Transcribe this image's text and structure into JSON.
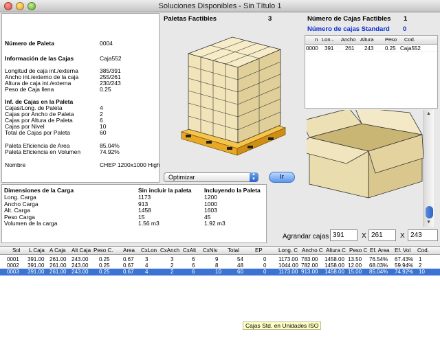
{
  "window": {
    "title": "Soluciones Disponibles - Sin Título 1"
  },
  "info": [
    {
      "label": "Número de Paleta",
      "value": "0004",
      "bold": true
    },
    {
      "label": "Información de las Cajas",
      "value": "Caja552",
      "bold": true
    },
    {
      "label": "Longitud de caja int./externa",
      "value": "385/391",
      "bold": false
    },
    {
      "label": "Ancho int./externo de la caja",
      "value": "255/261",
      "bold": false
    },
    {
      "label": "Altura de caja int./externa",
      "value": "230/243",
      "bold": false
    },
    {
      "label": "Peso de Caja llena",
      "value": "0.25",
      "bold": false
    },
    {
      "label": "Inf. de Cajas en la Paleta",
      "value": "",
      "bold": true
    },
    {
      "label": "Cajas/Long. de Paleta",
      "value": "4",
      "bold": false
    },
    {
      "label": "Cajas por Ancho de Paleta",
      "value": "2",
      "bold": false
    },
    {
      "label": "Cajas por Altura de Paleta",
      "value": "6",
      "bold": false
    },
    {
      "label": "Cajas por Nivel",
      "value": "10",
      "bold": false
    },
    {
      "label": "Total de Cajas por Paleta",
      "value": "60",
      "bold": false
    },
    {
      "label": "Paleta Eficiencia de Area",
      "value": "85.04%",
      "bold": false
    },
    {
      "label": "Paleta Eficiencia en Volumen",
      "value": "74.92%",
      "bold": false
    },
    {
      "label": "Nombre",
      "value": "CHEP 1200x1000 High",
      "bold": false
    }
  ],
  "load": {
    "header": {
      "label": "Dimensiones de la Carga",
      "col1": "Sin incluir la paleta",
      "col2": "Incluyendo la Paleta"
    },
    "rows": [
      {
        "label": "Long. Carga",
        "col1": "1173",
        "col2": "1200"
      },
      {
        "label": "Ancho Carga",
        "col1": "913",
        "col2": "1000"
      },
      {
        "label": "Alt. Carga",
        "col1": "1458",
        "col2": "1603"
      },
      {
        "label": "Peso Carga",
        "col1": "15",
        "col2": "45"
      },
      {
        "label": "Volumen de la carga",
        "col1": "1.56 m3",
        "col2": "1.92 m3"
      }
    ]
  },
  "pallets": {
    "label": "Paletas Factibles",
    "count": "3"
  },
  "feasible": {
    "label": "Número de Cajas Factibles",
    "count": "1",
    "std_label": "Número de cajas Standard",
    "std_count": "0",
    "columns": [
      "n",
      "Lon...",
      "Ancho",
      "Altura",
      "Peso",
      "Cod."
    ],
    "rows": [
      [
        "0000",
        "391",
        "261",
        "243",
        "0.25",
        "Caja552"
      ]
    ]
  },
  "controls": {
    "select_value": "Optimizar",
    "go_label": "Ir",
    "enlarge_label": "Agrandar cajas",
    "x1": "X",
    "x2": "X",
    "dim1": "391",
    "dim2": "261",
    "dim3": "243"
  },
  "results": {
    "columns": [
      "Sol",
      "L Caja",
      "A Caja",
      "Alt Caja",
      "Peso C.",
      "Area",
      "CxLon",
      "CxAnch",
      "CxAlt",
      "CxNiv",
      "Total",
      "EP",
      "Long. C",
      "Ancho C",
      "Altura C",
      "Peso C",
      "Ef. Area",
      "Ef. Vol",
      "Cod."
    ],
    "rows": [
      [
        "0001",
        "391.00",
        "261.00",
        "243.00",
        "0.25",
        "0.67",
        "3",
        "3",
        "6",
        "9",
        "54",
        "0",
        "1173.00",
        "783.00",
        "1458.00",
        "13.50",
        "76.54%",
        "67.43%",
        "1"
      ],
      [
        "0002",
        "391.00",
        "261.00",
        "243.00",
        "0.25",
        "0.67",
        "4",
        "2",
        "6",
        "8",
        "48",
        "0",
        "1044.00",
        "782.00",
        "1458.00",
        "12.00",
        "68.03%",
        "59.94%",
        "2"
      ],
      [
        "0003",
        "391.00",
        "261.00",
        "243.00",
        "0.25",
        "0.67",
        "4",
        "2",
        "6",
        "10",
        "60",
        "0",
        "1173.00",
        "913.00",
        "1458.00",
        "15.00",
        "85.04%",
        "74.92%",
        "10"
      ]
    ],
    "selected_index": 2
  },
  "tooltip": "Cajas Std. en Unidades ISO",
  "colors": {
    "selection": "#3a73d1",
    "box": "#eee0b0",
    "pallet": "#f0b530",
    "accent_blue": "#0a2fd4"
  }
}
